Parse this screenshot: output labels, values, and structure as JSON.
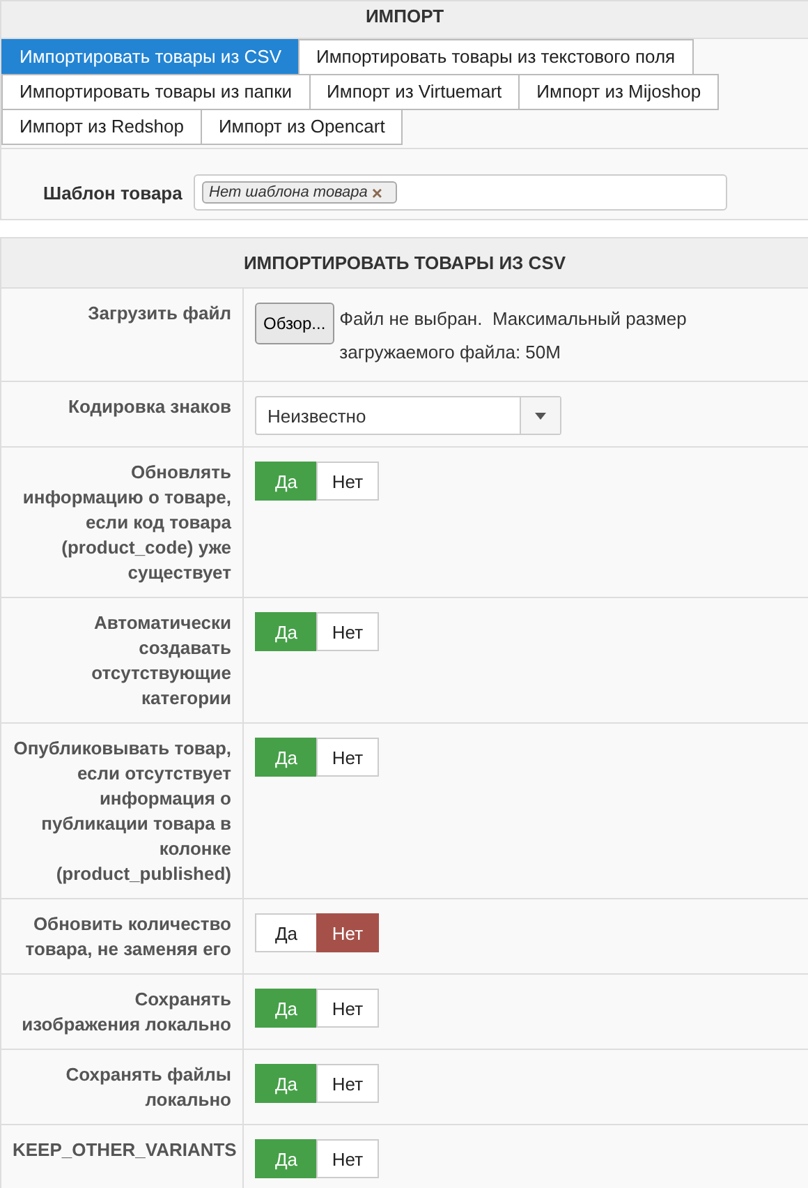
{
  "panel_title": "ИМПОРТ",
  "tabs": [
    {
      "label": "Импортировать товары из CSV",
      "selected": true
    },
    {
      "label": "Импортировать товары из текстового поля",
      "selected": false
    },
    {
      "label": "Импортировать товары из папки",
      "selected": false
    },
    {
      "label": "Импорт из Virtuemart",
      "selected": false
    },
    {
      "label": "Импорт из Mijoshop",
      "selected": false
    },
    {
      "label": "Импорт из Redshop",
      "selected": false
    },
    {
      "label": "Импорт из Opencart",
      "selected": false
    }
  ],
  "template": {
    "label": "Шаблон товара",
    "tag": "Нет шаблона товара",
    "remove": "×"
  },
  "section_title": "ИМПОРТИРОВАТЬ ТОВАРЫ ИЗ CSV",
  "rows": [
    {
      "kind": "file",
      "label": "Загрузить файл",
      "button": "Обзор...",
      "status": "Файл не выбран.",
      "note": "Максимальный размер загружаемого файла: 50M"
    },
    {
      "kind": "select",
      "label": "Кодировка знаков",
      "value": "Неизвестно"
    },
    {
      "kind": "toggle",
      "label": "Обновлять информацию о товаре, если код товара (product_code) уже существует",
      "options": [
        {
          "label": "Да",
          "selected": true
        },
        {
          "label": "Нет",
          "selected": false
        }
      ]
    },
    {
      "kind": "toggle",
      "label": "Автоматически создавать отсутствующие категории",
      "options": [
        {
          "label": "Да",
          "selected": true
        },
        {
          "label": "Нет",
          "selected": false
        }
      ]
    },
    {
      "kind": "toggle",
      "label": "Опубликовывать товар, если отсутствует информация о публикации товара в колонке (product_published)",
      "options": [
        {
          "label": "Да",
          "selected": true
        },
        {
          "label": "Нет",
          "selected": false
        }
      ]
    },
    {
      "kind": "toggle",
      "label": "Обновить количество товара, не заменяя его",
      "options": [
        {
          "label": "Да",
          "selected": false
        },
        {
          "label": "Нет",
          "selected": true
        }
      ]
    },
    {
      "kind": "toggle",
      "label": "Сохранять изображения локально",
      "options": [
        {
          "label": "Да",
          "selected": true
        },
        {
          "label": "Нет",
          "selected": false
        }
      ]
    },
    {
      "kind": "toggle",
      "label": "Сохранять файлы локально",
      "options": [
        {
          "label": "Да",
          "selected": true
        },
        {
          "label": "Нет",
          "selected": false
        }
      ]
    },
    {
      "kind": "toggle",
      "label": "KEEP_OTHER_VARIANTS",
      "options": [
        {
          "label": "Да",
          "selected": true
        },
        {
          "label": "Нет",
          "selected": false
        }
      ]
    }
  ]
}
